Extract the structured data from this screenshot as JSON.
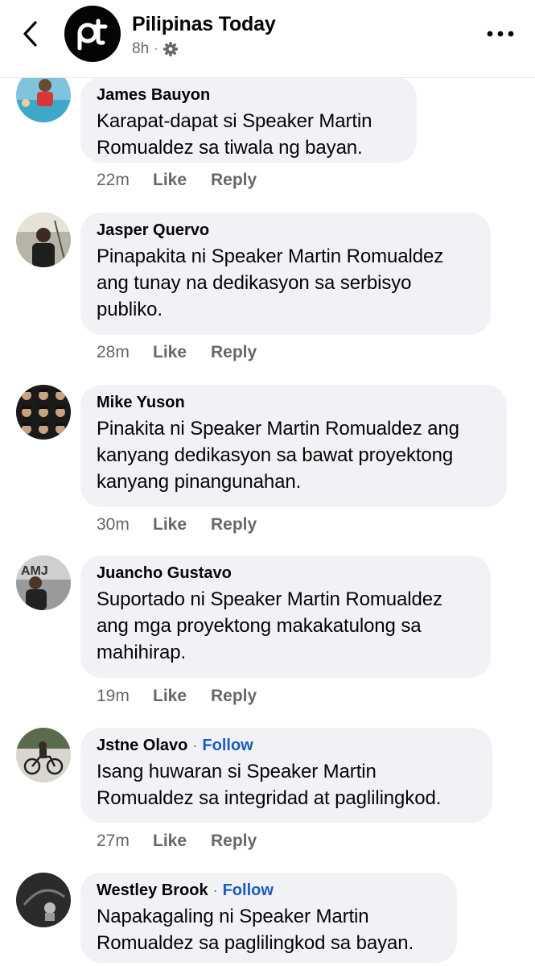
{
  "header": {
    "page_name": "Pilipinas Today",
    "logo_text": "pt",
    "post_age": "8h",
    "separator": "·",
    "audience_icon": "gear-icon",
    "back_icon": "chevron-left-icon",
    "more_icon": "more-horizontal-icon"
  },
  "comment_actions": {
    "like": "Like",
    "reply": "Reply"
  },
  "comments": [
    {
      "author": "James Bauyon",
      "text": "Karapat-dapat si Speaker Martin Romualdez sa tiwala ng bayan.",
      "time": "22m"
    },
    {
      "author": "Jasper Quervo",
      "text": "Pinapakita ni Speaker Martin Romualdez ang tunay na dedikasyon sa serbisyo publiko.",
      "time": "28m"
    },
    {
      "author": "Mike Yuson",
      "text": "Pinakita ni Speaker Martin Romualdez ang kanyang dedikasyon sa bawat proyektong kanyang pinangunahan.",
      "time": "30m"
    },
    {
      "author": "Juancho Gustavo",
      "text": "Suportado ni Speaker Martin Romualdez ang mga proyektong makakatulong sa mahihirap.",
      "time": "19m"
    },
    {
      "author": "Jstne Olavo",
      "follow": "Follow",
      "separator": "·",
      "text": "Isang huwaran si Speaker Martin Romualdez sa integridad at paglilingkod.",
      "time": "27m"
    },
    {
      "author": "Westley Brook",
      "follow": "Follow",
      "separator": "·",
      "text": "Napakagaling ni Speaker Martin Romualdez sa paglilingkod sa bayan."
    }
  ],
  "colors": {
    "bubble": "#f0f2f5",
    "secondary_text": "#65676b",
    "follow_link": "#1d5bbf"
  }
}
